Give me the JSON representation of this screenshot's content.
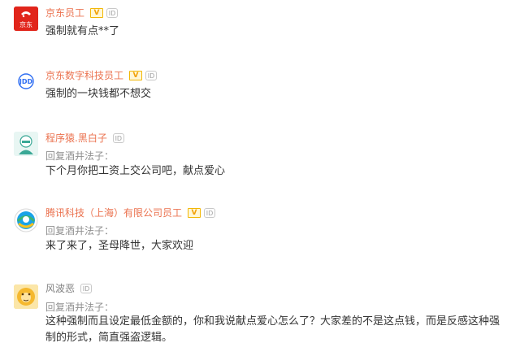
{
  "comments": [
    {
      "username": "京东员工",
      "avatar_logo": "京东",
      "avatar_icon": "jd-logo",
      "verified_badge": "V",
      "id_badge": "ID",
      "reply_to": "",
      "text": "强制就有点**了"
    },
    {
      "username": "京东数字科技员工",
      "avatar_logo": "JDD",
      "avatar_icon": "jdd-logo",
      "verified_badge": "V",
      "id_badge": "ID",
      "reply_to": "",
      "text": "强制的一块钱都不想交"
    },
    {
      "username": "程序猿.黑白子",
      "avatar_icon": "programmer-avatar",
      "id_badge": "ID",
      "reply_to": "回复酒井法子：",
      "text": "下个月你把工资上交公司吧，献点爱心"
    },
    {
      "username": "腾讯科技（上海）有限公司员工",
      "avatar_icon": "tencent-logo",
      "verified_badge": "V",
      "id_badge": "ID",
      "reply_to": "回复酒井法子：",
      "text": "来了来了，圣母降世，大家欢迎"
    },
    {
      "username": "风波恶",
      "avatar_icon": "cartoon-avatar",
      "id_badge": "ID",
      "reply_to": "回复酒井法子：",
      "text": "这种强制而且设定最低金额的，你和我说献点爱心怎么了？大家差的不是这点钱，而是反感这种强制的形式，简直强盗逻辑。"
    }
  ],
  "colors": {
    "name": "#eb7350",
    "name_gray": "#808080",
    "reply": "#909090",
    "text": "#333333",
    "jd_red": "#e1251b",
    "verified": "#f2b705"
  }
}
